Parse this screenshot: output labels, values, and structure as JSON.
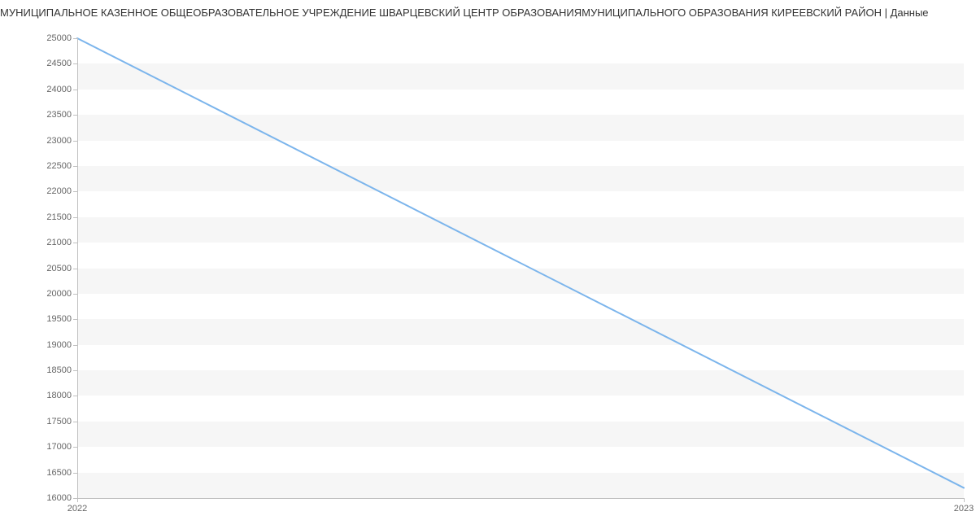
{
  "chart_data": {
    "type": "line",
    "title": "МУНИЦИПАЛЬНОЕ КАЗЕННОЕ ОБЩЕОБРАЗОВАТЕЛЬНОЕ УЧРЕЖДЕНИЕ ШВАРЦЕВСКИЙ ЦЕНТР ОБРАЗОВАНИЯМУНИЦИПАЛЬНОГО ОБРАЗОВАНИЯ КИРЕЕВСКИЙ РАЙОН | Данные",
    "categories": [
      "2022",
      "2023"
    ],
    "values": [
      25000,
      16200
    ],
    "xlabel": "",
    "ylabel": "",
    "ylim": [
      16000,
      25000
    ],
    "y_ticks": [
      16000,
      16500,
      17000,
      17500,
      18000,
      18500,
      19000,
      19500,
      20000,
      20500,
      21000,
      21500,
      22000,
      22500,
      23000,
      23500,
      24000,
      24500,
      25000
    ],
    "line_color": "#7cb5ec"
  }
}
